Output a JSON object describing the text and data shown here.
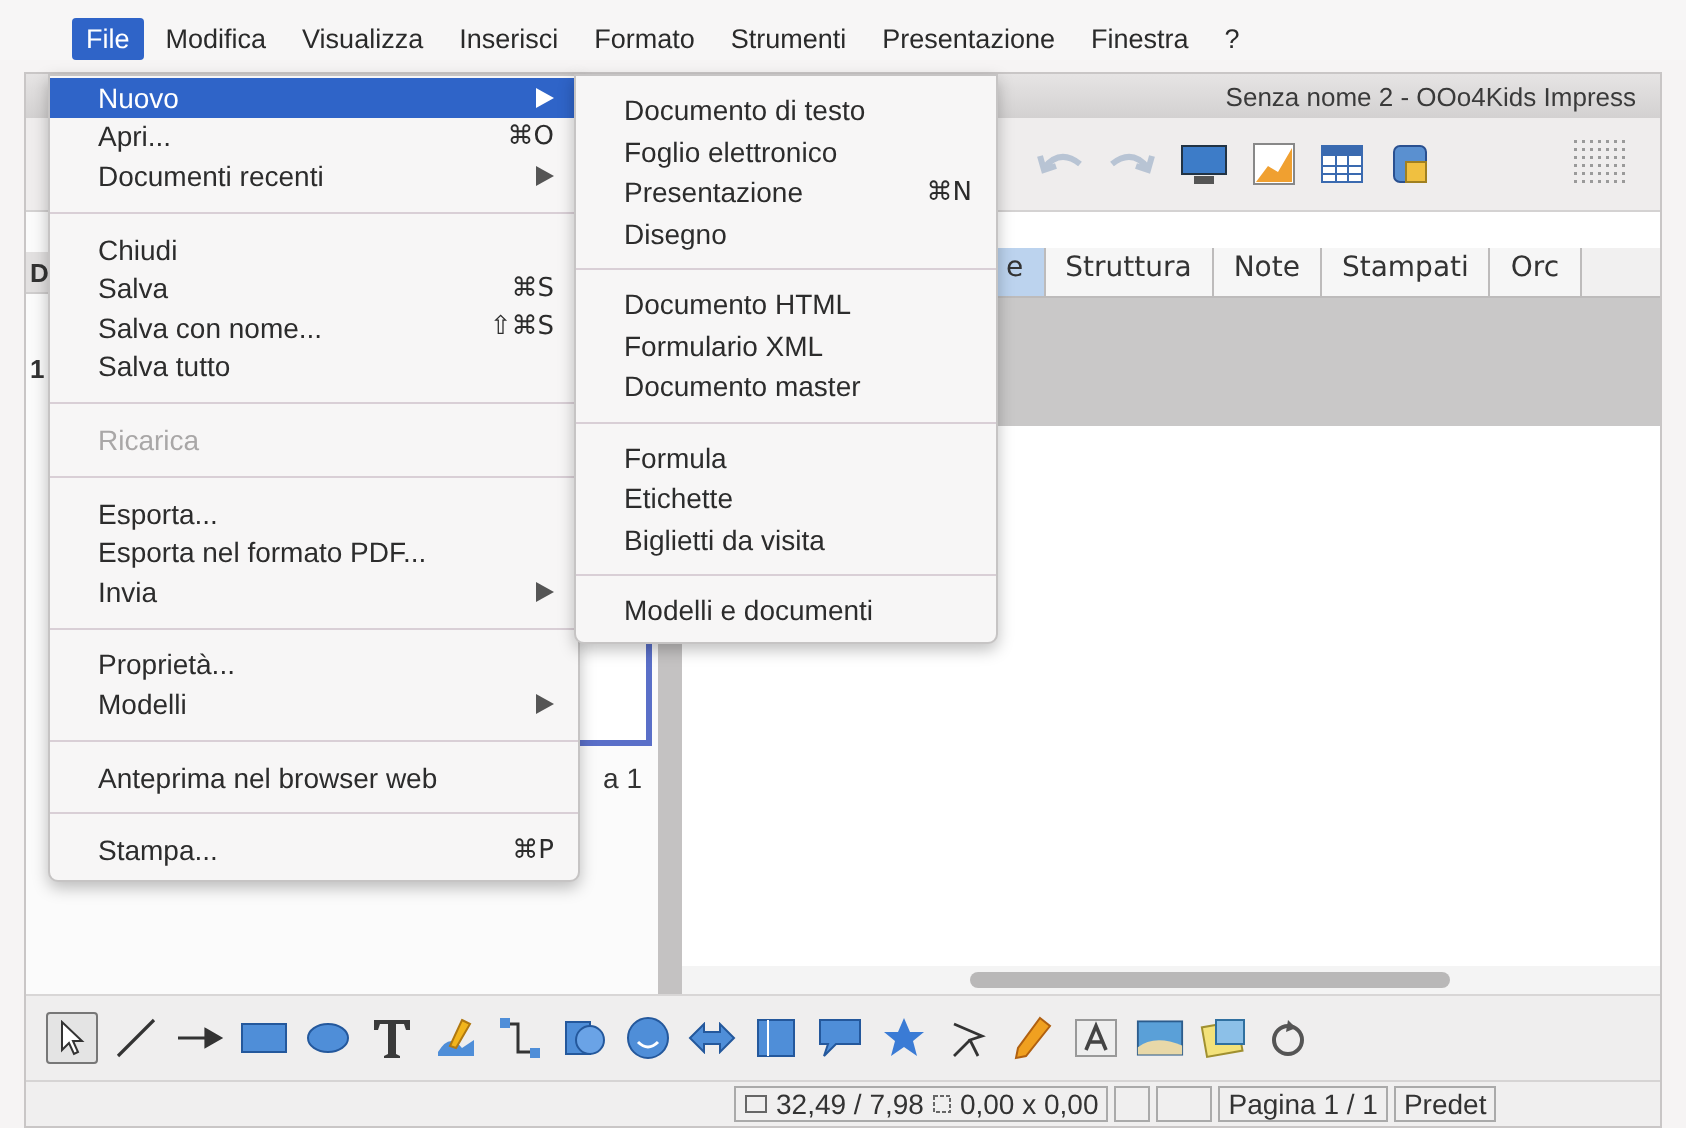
{
  "menu_bar": [
    {
      "label": "File",
      "selected": true
    },
    {
      "label": "Modifica",
      "selected": false
    },
    {
      "label": "Visualizza",
      "selected": false
    },
    {
      "label": "Inserisci",
      "selected": false
    },
    {
      "label": "Formato",
      "selected": false
    },
    {
      "label": "Strumenti",
      "selected": false
    },
    {
      "label": "Presentazione",
      "selected": false
    },
    {
      "label": "Finestra",
      "selected": false
    },
    {
      "label": "?",
      "selected": false
    }
  ],
  "window": {
    "title": "Senza nome 2 - OOo4Kids Impress"
  },
  "slide_panel": {
    "header": "D",
    "slide_number": "1",
    "caption": "a 1"
  },
  "view_tabs": [
    {
      "label": "e",
      "selected": true
    },
    {
      "label": "Struttura",
      "selected": false
    },
    {
      "label": "Note",
      "selected": false
    },
    {
      "label": "Stampati",
      "selected": false
    },
    {
      "label": "Orc",
      "selected": false
    }
  ],
  "file_menu": [
    {
      "kind": "item",
      "label": "Nuovo",
      "submenu": true,
      "selected": true,
      "disabled": false
    },
    {
      "kind": "item",
      "label": "Apri...",
      "shortcut": "⌘O",
      "submenu": false,
      "selected": false,
      "disabled": false
    },
    {
      "kind": "item",
      "label": "Documenti recenti",
      "submenu": true,
      "selected": false,
      "disabled": false
    },
    {
      "kind": "separator"
    },
    {
      "kind": "item",
      "label": "Chiudi",
      "submenu": false,
      "selected": false,
      "disabled": false
    },
    {
      "kind": "item",
      "label": "Salva",
      "shortcut": "⌘S",
      "submenu": false,
      "selected": false,
      "disabled": false
    },
    {
      "kind": "item",
      "label": "Salva con nome...",
      "shortcut": "⇧⌘S",
      "submenu": false,
      "selected": false,
      "disabled": false
    },
    {
      "kind": "item",
      "label": "Salva tutto",
      "submenu": false,
      "selected": false,
      "disabled": false
    },
    {
      "kind": "separator"
    },
    {
      "kind": "item",
      "label": "Ricarica",
      "submenu": false,
      "selected": false,
      "disabled": true
    },
    {
      "kind": "separator"
    },
    {
      "kind": "item",
      "label": "Esporta...",
      "submenu": false,
      "selected": false,
      "disabled": false
    },
    {
      "kind": "item",
      "label": "Esporta nel formato PDF...",
      "submenu": false,
      "selected": false,
      "disabled": false
    },
    {
      "kind": "item",
      "label": "Invia",
      "submenu": true,
      "selected": false,
      "disabled": false
    },
    {
      "kind": "separator"
    },
    {
      "kind": "item",
      "label": "Proprietà...",
      "submenu": false,
      "selected": false,
      "disabled": false
    },
    {
      "kind": "item",
      "label": "Modelli",
      "submenu": true,
      "selected": false,
      "disabled": false
    },
    {
      "kind": "separator"
    },
    {
      "kind": "item",
      "label": "Anteprima nel browser web",
      "submenu": false,
      "selected": false,
      "disabled": false
    },
    {
      "kind": "separator"
    },
    {
      "kind": "item",
      "label": "Stampa...",
      "shortcut": "⌘P",
      "submenu": false,
      "selected": false,
      "disabled": false
    }
  ],
  "new_submenu": [
    {
      "kind": "item",
      "label": "Documento di testo"
    },
    {
      "kind": "item",
      "label": "Foglio elettronico"
    },
    {
      "kind": "item",
      "label": "Presentazione",
      "shortcut": "⌘N"
    },
    {
      "kind": "item",
      "label": "Disegno"
    },
    {
      "kind": "separator"
    },
    {
      "kind": "item",
      "label": "Documento HTML"
    },
    {
      "kind": "item",
      "label": "Formulario XML"
    },
    {
      "kind": "item",
      "label": "Documento master"
    },
    {
      "kind": "separator"
    },
    {
      "kind": "item",
      "label": "Formula"
    },
    {
      "kind": "item",
      "label": "Etichette"
    },
    {
      "kind": "item",
      "label": "Biglietti da visita"
    },
    {
      "kind": "separator"
    },
    {
      "kind": "item",
      "label": "Modelli e documenti"
    }
  ],
  "drawing_tools": [
    {
      "kind": "select",
      "selected": true
    },
    {
      "kind": "line",
      "selected": false
    },
    {
      "kind": "arrow",
      "selected": false
    },
    {
      "kind": "rectangle",
      "selected": false
    },
    {
      "kind": "ellipse",
      "selected": false
    },
    {
      "kind": "text",
      "selected": false
    },
    {
      "kind": "curve",
      "selected": false
    },
    {
      "kind": "connector",
      "selected": false
    },
    {
      "kind": "shapes",
      "selected": false
    },
    {
      "kind": "smiley",
      "selected": false
    },
    {
      "kind": "double-arrow",
      "selected": false
    },
    {
      "kind": "flowchart",
      "selected": false
    },
    {
      "kind": "callout",
      "selected": false
    },
    {
      "kind": "star",
      "selected": false
    },
    {
      "kind": "points",
      "selected": false
    },
    {
      "kind": "pencil",
      "selected": false
    },
    {
      "kind": "fontwork",
      "selected": false
    },
    {
      "kind": "image",
      "selected": false
    },
    {
      "kind": "gallery",
      "selected": false
    },
    {
      "kind": "rotate",
      "selected": false
    }
  ],
  "status_bar": {
    "position": "32,49 / 7,98",
    "size": "0,00 x 0,00",
    "page": "Pagina 1 / 1",
    "layout": "Predet"
  }
}
